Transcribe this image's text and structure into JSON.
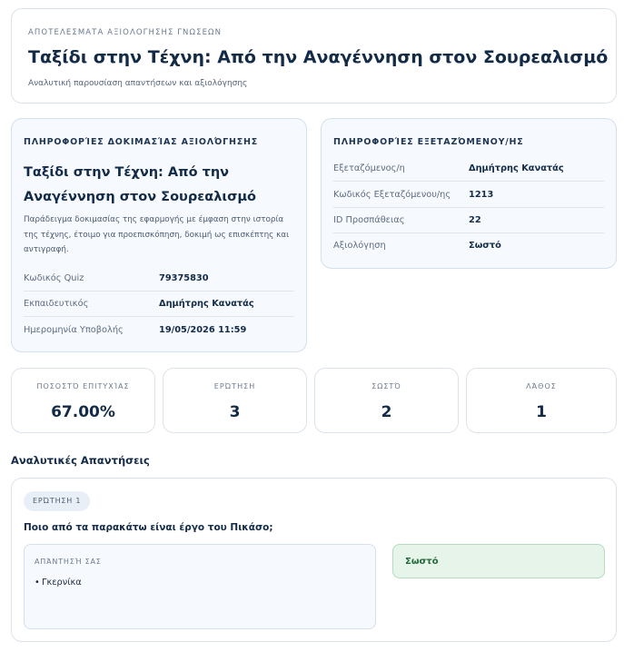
{
  "header": {
    "eyebrow": "ΑΠΟΤΕΛΕΣΜΑΤΑ ΑΞΙΟΛΟΓΗΣΗΣ ΓΝΩΣΕΩΝ",
    "title": "Ταξίδι στην Τέχνη: Από την Αναγέννηση στον Σουρεαλισμό",
    "subtitle": "Αναλυτική παρουσίαση απαντήσεων και αξιολόγησης"
  },
  "quiz_info": {
    "heading": "ΠΛΗΡΟΦΟΡΊΕΣ ΔΟΚΙΜΑΣΊΑΣ ΑΞΙΟΛΌΓΗΣΗΣ",
    "title": "Ταξίδι στην Τέχνη: Από την Αναγέννηση στον Σουρεαλισμό",
    "description": "Παράδειγμα δοκιμασίας της εφαρμογής με έμφαση στην ιστορία της τέχνης, έτοιμο για προεπισκόπηση, δοκιμή ως επισκέπτης και αντιγραφή.",
    "rows": [
      {
        "label": "Κωδικός Quiz",
        "value": "79375830"
      },
      {
        "label": "Εκπαιδευτικός",
        "value": "Δημήτρης Κανατάς"
      },
      {
        "label": "Ημερομηνία Υποβολής",
        "value": "19/05/2026 11:59"
      }
    ]
  },
  "examinee_info": {
    "heading": "ΠΛΗΡΟΦΟΡΊΕΣ ΕΞΕΤΑΖΌΜΕΝΟΥ/ΗΣ",
    "rows": [
      {
        "label": "Εξεταζόμενος/η",
        "value": "Δημήτρης Κανατάς"
      },
      {
        "label": "Κωδικός Εξεταζόμενου/ης",
        "value": "1213"
      },
      {
        "label": "ID Προσπάθειας",
        "value": "22"
      },
      {
        "label": "Αξιολόγηση",
        "value": "Σωστό"
      }
    ]
  },
  "stats": [
    {
      "label": "ΠΟΣΟΣΤΌ ΕΠΙΤΥΧΊΑΣ",
      "value": "67.00%"
    },
    {
      "label": "ΕΡΏΤΗΣΗ",
      "value": "3"
    },
    {
      "label": "ΣΩΣΤΌ",
      "value": "2"
    },
    {
      "label": "ΛΆΘΟΣ",
      "value": "1"
    }
  ],
  "answers": {
    "heading": "Αναλυτικές Απαντήσεις",
    "items": [
      {
        "badge": "ΕΡΏΤΗΣΗ 1",
        "question": "Ποιο από τα παρακάτω είναι έργο του Πικάσο;",
        "your_answer_label": "ΑΠΆΝΤΗΣΉ ΣΑΣ",
        "your_answer": "Γκερνίκα",
        "result": "Σωστό"
      }
    ]
  }
}
